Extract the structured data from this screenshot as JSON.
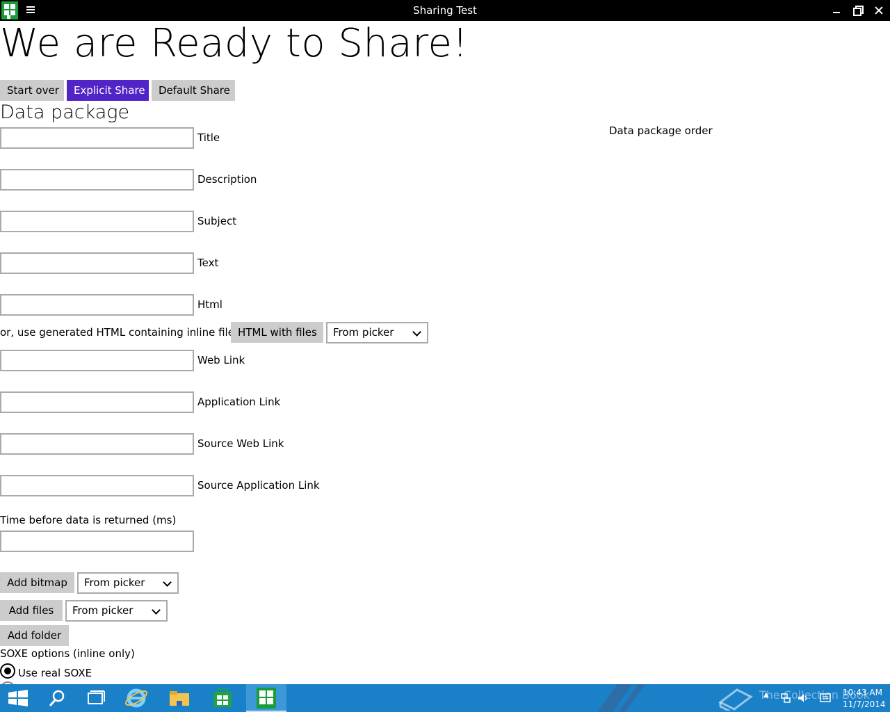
{
  "window": {
    "title": "Sharing Test"
  },
  "heading": "We are Ready to Share!",
  "buttons": {
    "start_over": "Start over",
    "explicit_share": "Explicit Share",
    "default_share": "Default Share"
  },
  "section_title": "Data package",
  "order_label": "Data package order",
  "fields": {
    "title": {
      "label": "Title",
      "value": ""
    },
    "description": {
      "label": "Description",
      "value": ""
    },
    "subject": {
      "label": "Subject",
      "value": ""
    },
    "text": {
      "label": "Text",
      "value": ""
    },
    "html": {
      "label": "Html",
      "value": ""
    },
    "web_link": {
      "label": "Web Link",
      "value": ""
    },
    "application_link": {
      "label": "Application Link",
      "value": ""
    },
    "source_web_link": {
      "label": "Source Web Link",
      "value": ""
    },
    "source_application_link": {
      "label": "Source Application Link",
      "value": ""
    },
    "delay": {
      "label": "Time before data is returned (ms)",
      "value": ""
    }
  },
  "html_row": {
    "prefix": "or, use generated HTML containing inline files",
    "button": "HTML with files",
    "source": "From picker"
  },
  "bitmap": {
    "button": "Add bitmap",
    "source": "From picker"
  },
  "files": {
    "button": "Add files",
    "source": "From picker"
  },
  "folder": {
    "button": "Add folder"
  },
  "soxe": {
    "title": "SOXE options (inline only)",
    "option_real": "Use real SOXE"
  },
  "tray": {
    "time": "10:43 AM",
    "date": "11/7/2014",
    "watermark": "The Collection Book"
  },
  "colors": {
    "accent": "#5224c8",
    "taskbar": "#1a80c8",
    "app_icon": "#199c3a"
  }
}
